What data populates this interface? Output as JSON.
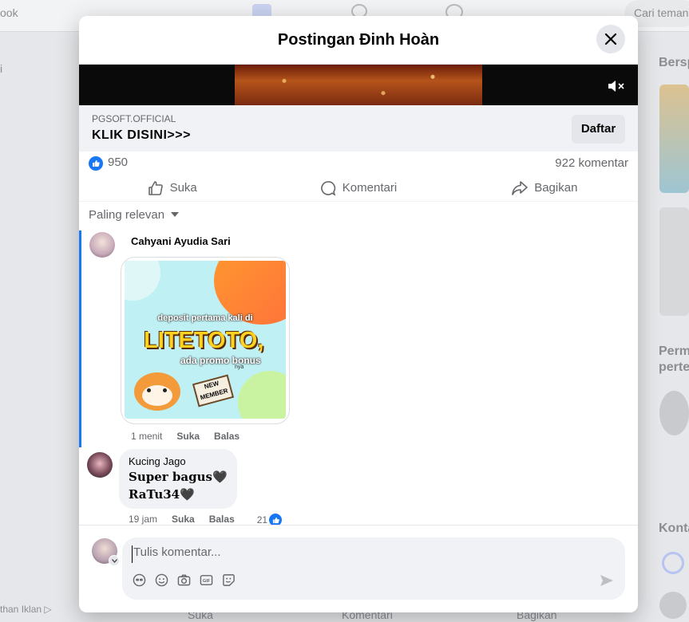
{
  "background": {
    "top_left": "ook",
    "search": "Cari teman",
    "right_heading1": "Bersp",
    "right_heading2a": "Perm",
    "right_heading2b": "perte",
    "right_heading3": "Konta",
    "bottom_left": "than Iklan ▷",
    "bottom_like": "Suka",
    "bottom_comment": "Komentari",
    "bottom_share": "Bagikan"
  },
  "modal": {
    "title": "Postingan Đinh Hoàn"
  },
  "ad": {
    "sponsor": "PGSOFT.OFFICIAL",
    "cta_text": "KLIK DISINI>>>",
    "button": "Daftar"
  },
  "stats": {
    "likes": "950",
    "comments": "922 komentar"
  },
  "actions": {
    "like": "Suka",
    "comment": "Komentari",
    "share": "Bagikan"
  },
  "sort": {
    "label": "Paling relevan"
  },
  "comments": [
    {
      "name": "Cahyani Ayudia Sari",
      "time": "1 menit",
      "like": "Suka",
      "reply": "Balas",
      "sticker": {
        "line1": "deposit pertama kali di",
        "brand": "LITETOTO,",
        "line3": "ada promo bonus",
        "line3b": "nya",
        "badge1": "NEW",
        "badge2": "MEMBER"
      }
    },
    {
      "name": "Kucing Jago",
      "text1": "Super bagus🖤",
      "text2": "RaTu34🖤",
      "time": "19 jam",
      "like": "Suka",
      "reply": "Balas",
      "reactions": "21"
    }
  ],
  "composer": {
    "placeholder": "Tulis komentar..."
  },
  "colors": {
    "accent": "#1877f2",
    "brand_title": "#c9262a"
  }
}
